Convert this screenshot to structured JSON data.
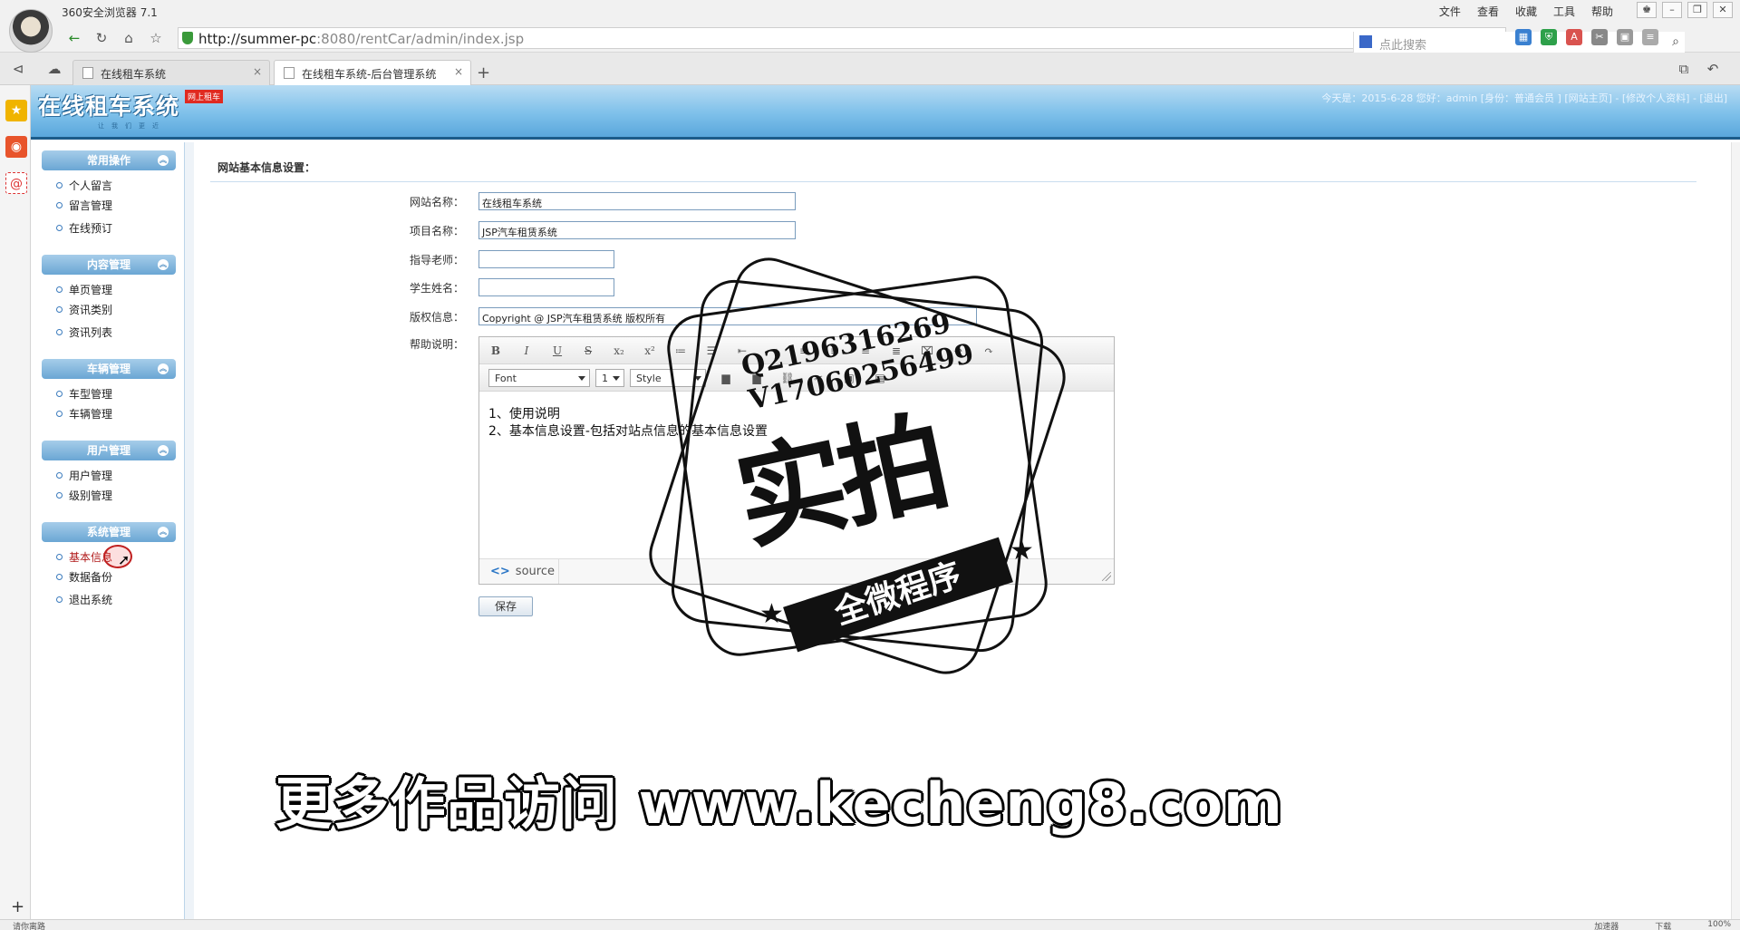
{
  "browser": {
    "name": "360安全浏览器 7.1",
    "menu": [
      "文件",
      "查看",
      "收藏",
      "工具",
      "帮助"
    ],
    "url_host": "http://summer-pc",
    "url_rest": ":8080/rentCar/admin/index.jsp",
    "search_placeholder": "点此搜索",
    "tabs": [
      {
        "label": "在线租车系统",
        "close": "×"
      },
      {
        "label": "在线租车系统-后台管理系统",
        "close": "×"
      }
    ],
    "new_tab": "+",
    "status_left": "请你离路",
    "status_right": [
      "加速器",
      "下载",
      "100%"
    ]
  },
  "header": {
    "logo": "在线租车系统",
    "badge": "网上租车",
    "slogan": "让我们更近",
    "info": "今天是：2015-6-28 您好：admin [身份：普通会员 ] [网站主页] - [修改个人资料] - [退出]"
  },
  "menu": {
    "groups": [
      {
        "title": "常用操作",
        "items": [
          "个人留言",
          "留言管理",
          "在线预订"
        ]
      },
      {
        "title": "内容管理",
        "items": [
          "单页管理",
          "资讯类别",
          "资讯列表"
        ]
      },
      {
        "title": "车辆管理",
        "items": [
          "车型管理",
          "车辆管理"
        ]
      },
      {
        "title": "用户管理",
        "items": [
          "用户管理",
          "级别管理"
        ]
      },
      {
        "title": "系统管理",
        "items": [
          "基本信息",
          "数据备份",
          "退出系统"
        ]
      }
    ],
    "toggle_glyph": "︽"
  },
  "form": {
    "section_title": "网站基本信息设置：",
    "labels": {
      "site_name": "网站名称：",
      "project_name": "项目名称：",
      "teacher": "指导老师：",
      "student": "学生姓名：",
      "copyright": "版权信息：",
      "help": "帮助说明："
    },
    "values": {
      "site_name": "在线租车系统",
      "project_name": "JSP汽车租赁系统",
      "teacher": "",
      "student": "",
      "copyright": "Copyright @ JSP汽车租赁系统  版权所有"
    },
    "editor": {
      "font": "Font",
      "size": "1",
      "style": "Style",
      "line1": "1、使用说明",
      "line2": "2、基本信息设置-包括对站点信息的基本信息设置",
      "source": "source"
    },
    "save": "保存"
  },
  "watermark": {
    "qq": "Q2196316269",
    "v": "V17060256499",
    "big": "实拍",
    "ribbon": "全微程序",
    "banner": "更多作品访问 www.kecheng8.com"
  }
}
